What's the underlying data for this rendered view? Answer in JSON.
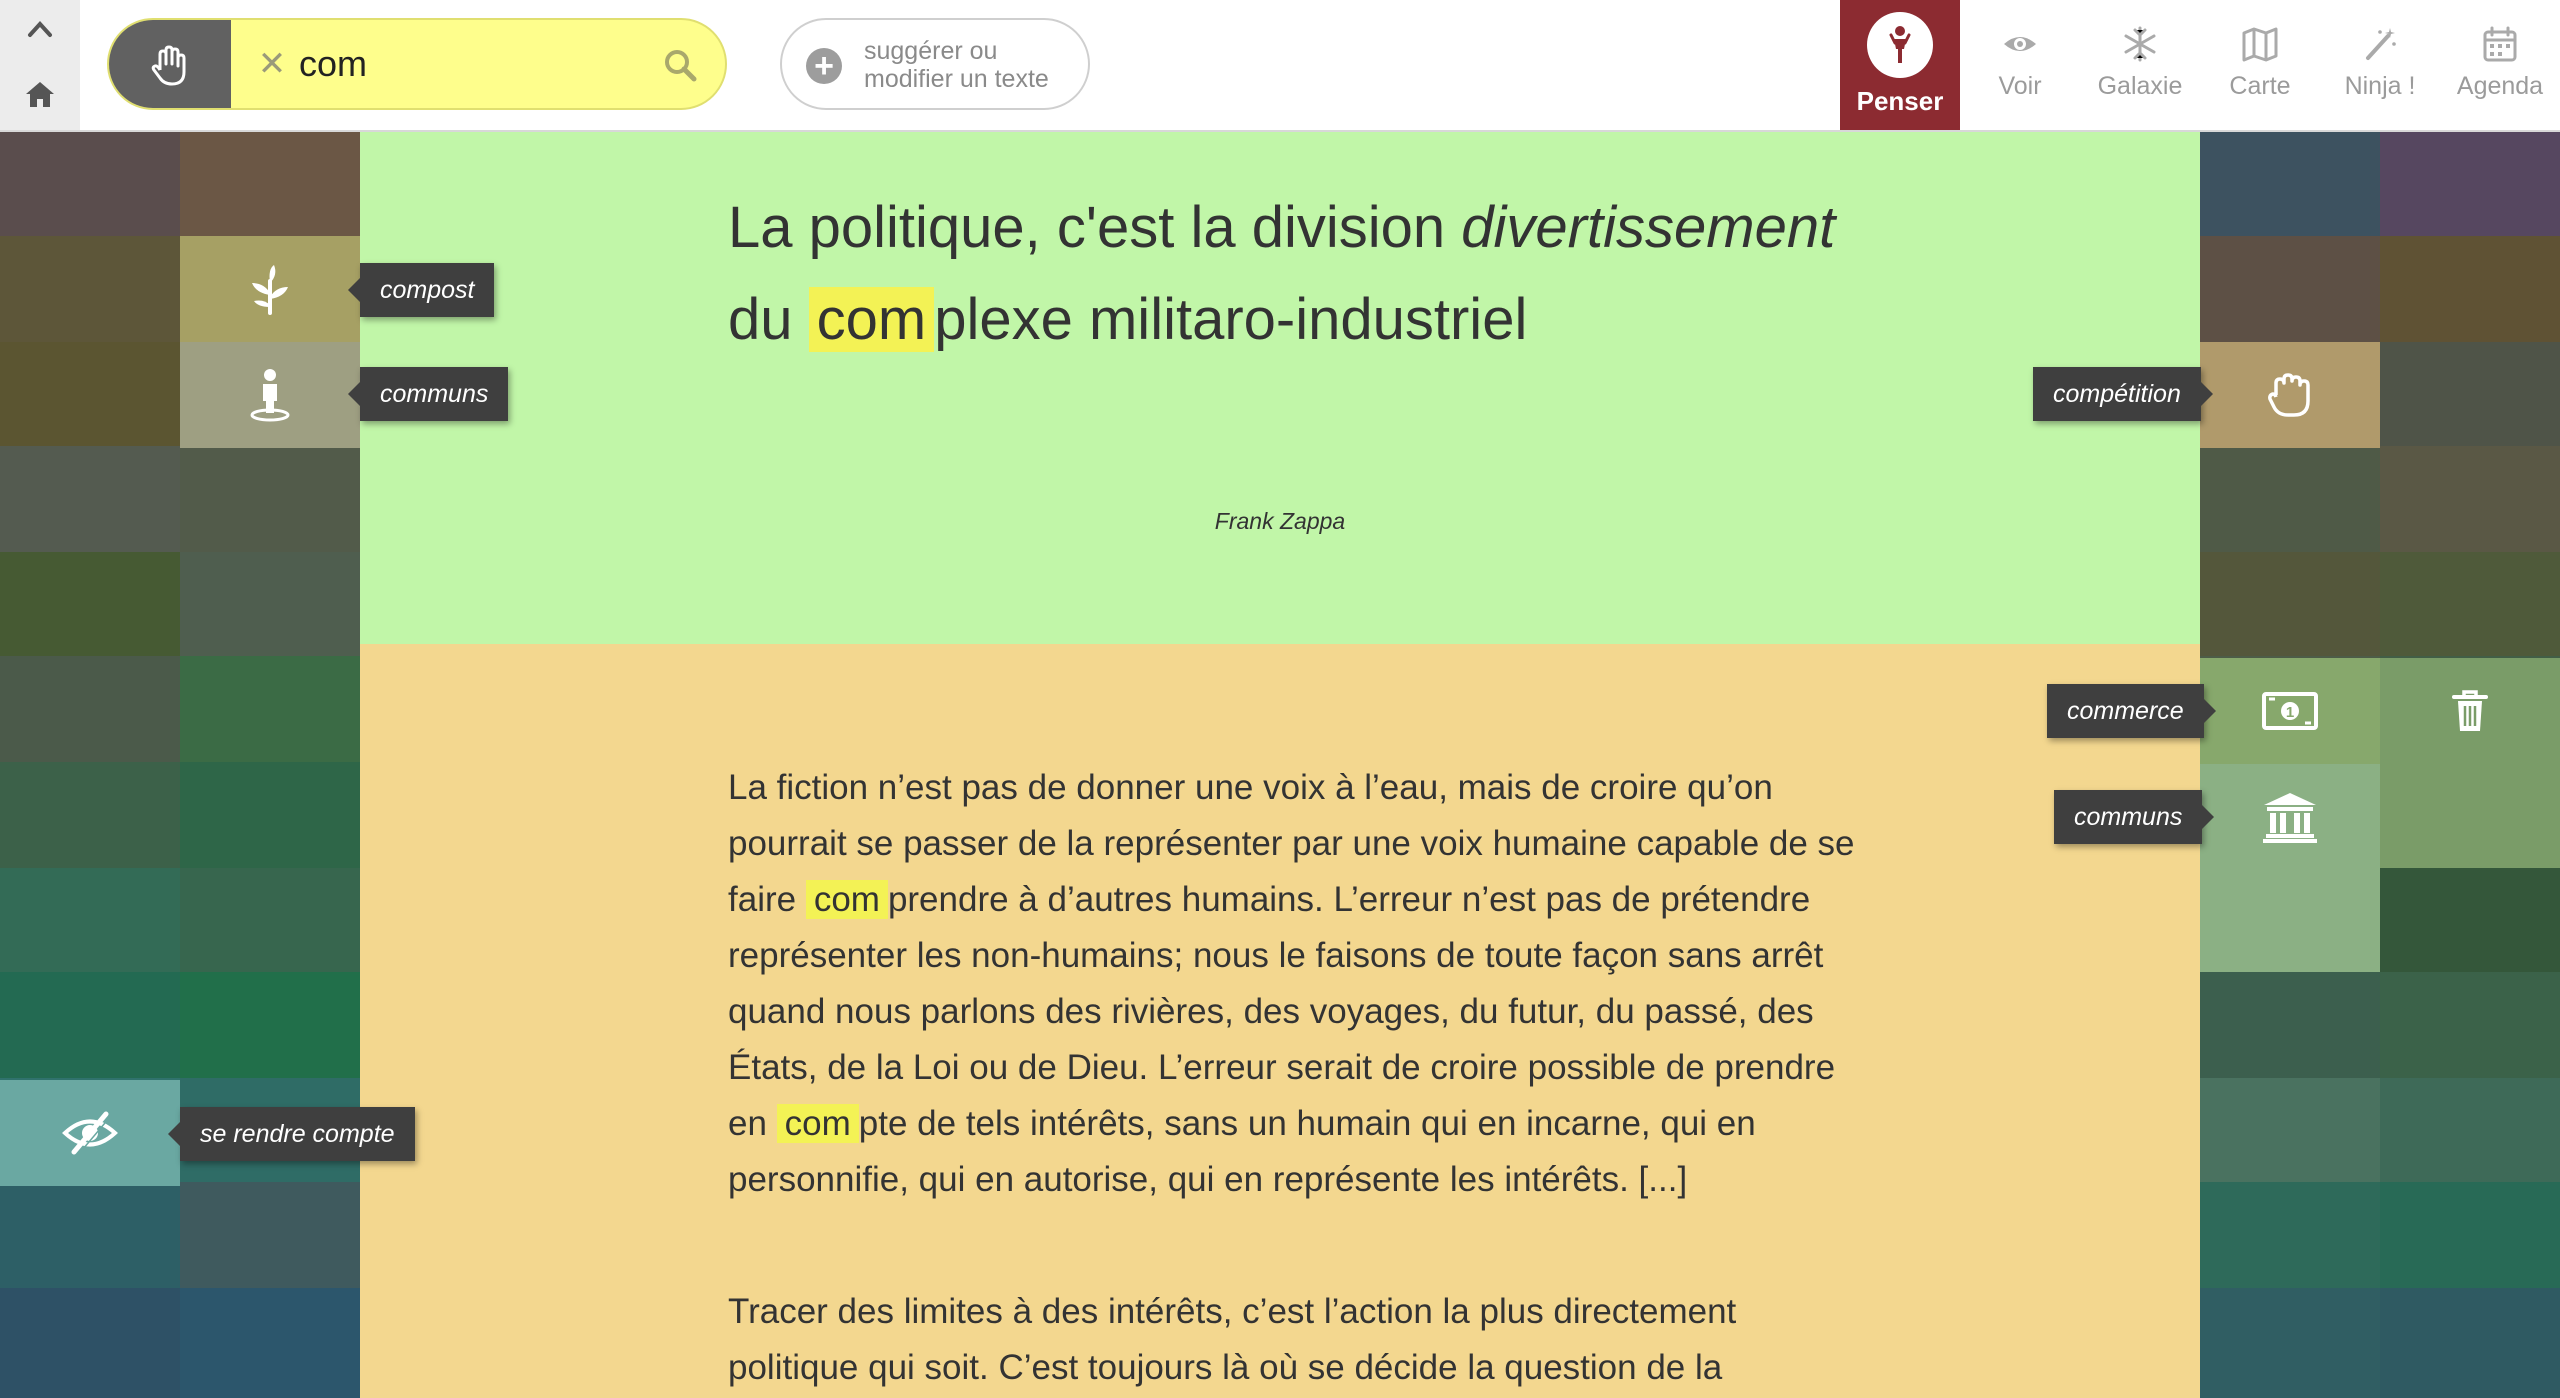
{
  "search": {
    "value": "com"
  },
  "suggest": {
    "label_line1": "suggérer ou",
    "label_line2": "modifier un texte"
  },
  "nav": [
    {
      "label": "Penser",
      "icon": "thinker-icon",
      "active": true
    },
    {
      "label": "Voir",
      "icon": "eye-icon"
    },
    {
      "label": "Galaxie",
      "icon": "snowflake-icon"
    },
    {
      "label": "Carte",
      "icon": "map-icon"
    },
    {
      "label": "Ninja !",
      "icon": "magic-wand-icon"
    },
    {
      "label": "Agenda",
      "icon": "calendar-icon"
    }
  ],
  "quote": {
    "part1": "La politique, c'est la division ",
    "italic": "divertissement",
    "part2": " du ",
    "highlight": "com",
    "part3": "plexe militaro-industriel",
    "author": "Frank Zappa"
  },
  "text": {
    "p1_a": "La fiction n’est pas de donner une voix à l’eau, mais de croire qu’on pourrait se passer de la représenter par une voix humaine capable de se faire ",
    "p1_hl1": "com",
    "p1_b": "prendre à d’autres humains. L’erreur n’est pas de prétendre représenter les non-humains; nous le faisons de toute façon sans arrêt quand nous parlons des rivières, des voyages, du futur, du passé, des États, de la Loi ou de Dieu. L’erreur serait de croire possible de prendre en ",
    "p1_hl2": "com",
    "p1_c": "pte de tels intérêts, sans un humain qui en incarne, qui en personnifie, qui en autorise, qui en représente les intérêts. [...]",
    "p2": "Tracer des limites à des intérêts, c’est l’action la plus directement politique qui soit. C’est toujours là où se décide la question de la"
  },
  "side_tags": {
    "compost": "compost",
    "communs_left": "communs",
    "competition": "compétition",
    "commerce": "commerce",
    "communs_right": "communs",
    "se_rendre_compte": "se rendre compte"
  },
  "colors": {
    "accent": "#8c2b31",
    "search_bg": "#fefe8c",
    "quote_bg": "#c1f6a8",
    "text_bg": "#f3d78f",
    "highlight": "#f3f255"
  }
}
